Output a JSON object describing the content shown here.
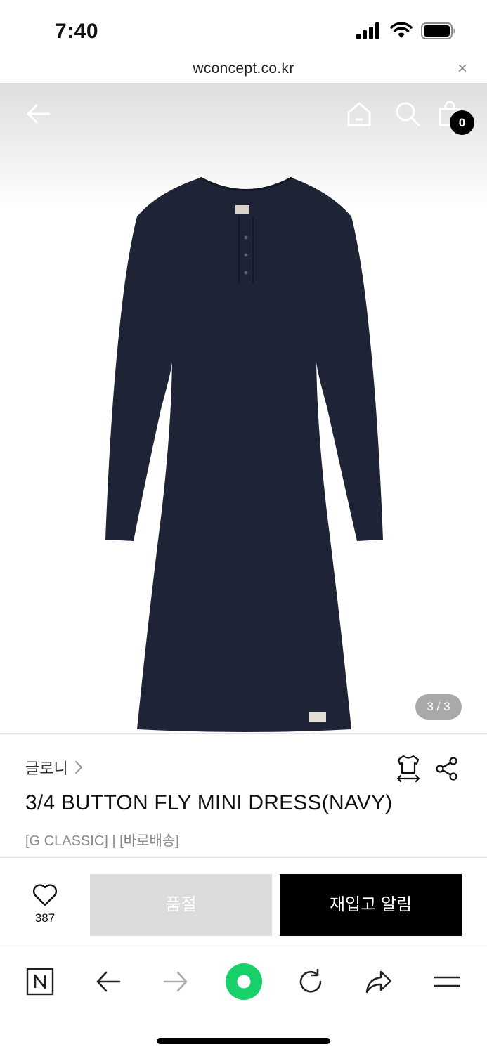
{
  "status": {
    "time": "7:40"
  },
  "browser": {
    "url": "wconcept.co.kr",
    "close_symbol": "×"
  },
  "header": {
    "cart_count": "0"
  },
  "gallery": {
    "indicator": "3 / 3"
  },
  "product": {
    "brand": "글로니",
    "title": "3/4 BUTTON FLY MINI DRESS(NAVY)",
    "meta": "[G CLASSIC] | [바로배송]"
  },
  "actions": {
    "like_count": "387",
    "soldout_label": "품절",
    "restock_label": "재입고 알림"
  },
  "colors": {
    "dress": "#1e2436",
    "accent_green": "#17d06a",
    "soldout_bg": "#dcdcdc",
    "primary": "#000000"
  }
}
